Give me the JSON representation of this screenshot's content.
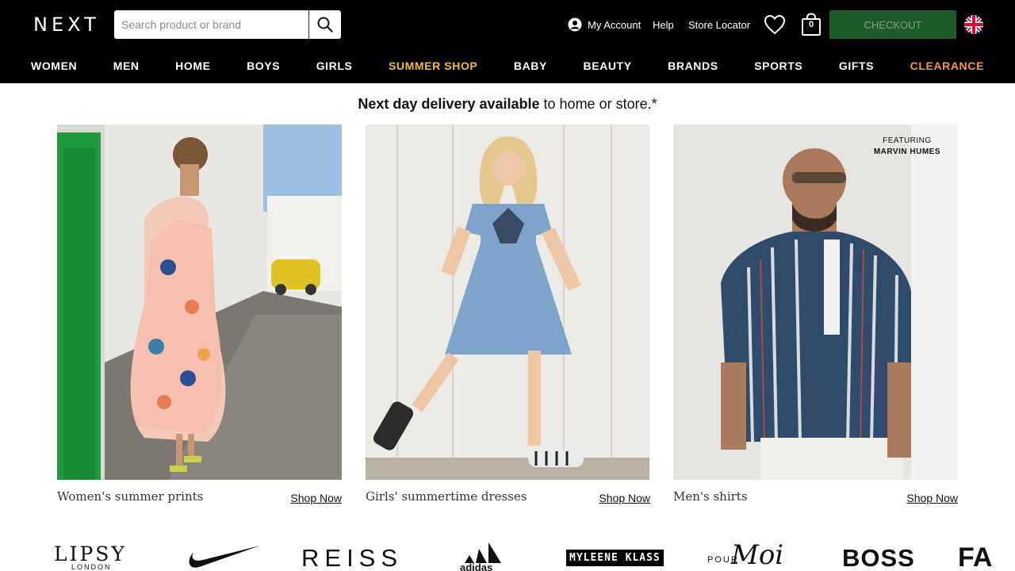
{
  "header": {
    "logo": "NEXT",
    "search": {
      "placeholder": "Search product or brand",
      "value": ""
    },
    "account_label": "My Account",
    "help_label": "Help",
    "store_locator_label": "Store Locator",
    "bag_count": "0",
    "checkout_label": "CHECKOUT"
  },
  "nav": {
    "items": [
      "WOMEN",
      "MEN",
      "HOME",
      "BOYS",
      "GIRLS",
      "SUMMER SHOP",
      "BABY",
      "BEAUTY",
      "BRANDS",
      "SPORTS",
      "GIFTS",
      "CLEARANCE"
    ]
  },
  "delivery": {
    "bold": "Next day delivery available",
    "rest": " to home or store.*"
  },
  "tiles": [
    {
      "caption": "Women's summer prints",
      "link": "Shop Now"
    },
    {
      "caption": "Girls' summertime dresses",
      "link": "Shop Now"
    },
    {
      "caption": "Men's shirts",
      "link": "Shop Now",
      "featuring_label": "FEATURING",
      "featuring_name": "MARVIN HUMES"
    }
  ],
  "brands": {
    "lipsy": "LIPSY",
    "lipsy_sub": "LONDON",
    "reiss": "REISS",
    "adidas": "adidas",
    "myleene": "MYLEENE KLASS",
    "pour": "POUR",
    "moi": "Moi",
    "boss": "BOSS",
    "fat": "FA"
  },
  "colors": {
    "header_bg": "#000000",
    "checkout_bg": "#1e5a2b",
    "summer_accent": "#f0bc3c",
    "clearance_accent": "#f29a3c"
  }
}
